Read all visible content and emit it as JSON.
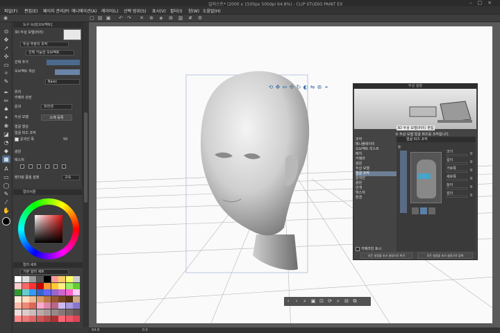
{
  "window": {
    "title": "일러스트* (2000 x 1500px 500dpi 64.8%) - CLIP STUDIO PAINT EX",
    "controls": [
      "–",
      "□",
      "×"
    ]
  },
  "menu": [
    "파일(F)",
    "편집(E)",
    "페이지 관리(P)",
    "애니메이션(A)",
    "레이어(L)",
    "선택 범위(S)",
    "표시(V)",
    "필터(I)",
    "창(W)",
    "도움말(H)"
  ],
  "tool_property": {
    "header": "도구 속성[오브젝트]",
    "title_label": "3D 두상 모델(머리)",
    "target_dropdown": "두상 부분의 조작",
    "selectable_dropdown": "선택 가능한 오브젝트",
    "select_add_label": "선택 추가",
    "tone_label": "오브젝트 색상",
    "layer_name": "Basic",
    "section_position": "위치",
    "section_camera": "카메라 관련",
    "section_outline": "윤곽",
    "outline_dropdown": "프리셋",
    "head_model_label": "두상 모델",
    "load_button": "소재 등록",
    "face_shape_label": "얼굴 형상",
    "face_parts_label": "얼굴 파츠 조작",
    "contour_label": "윤곽선 폭",
    "contour_value": "50",
    "section_light": "광원",
    "section_texture": "텍스처",
    "texture_dropdown": "고속",
    "render_label": "렌더링 품질 설정"
  },
  "color_panel": {
    "header": "컬러서클"
  },
  "swatch_panel": {
    "header": "컬러 세트",
    "set_name": "기본 컬러 세트",
    "colors": [
      "#ffffff",
      "#dddddd",
      "#999999",
      "#555555",
      "#000000",
      "#ff9999",
      "#ffcc66",
      "#ffff66",
      "#cccccc",
      "#ffcccc",
      "#ff6666",
      "#ff3333",
      "#cc0000",
      "#ff9933",
      "#ffcc33",
      "#ffee88",
      "#99ee66",
      "#66cc33",
      "#339933",
      "#66cccc",
      "#3399ff",
      "#3366cc",
      "#6666ff",
      "#9966cc",
      "#cc66cc",
      "#ff66cc",
      "#ffccff",
      "#ffeedd",
      "#ffddbb",
      "#eebb99",
      "#dd9966",
      "#bb7744",
      "#995533",
      "#774422",
      "#553311",
      "#ccaa88",
      "#ffbbaa",
      "#ee8877",
      "#dd6655",
      "#ffaacc",
      "#dd88aa",
      "#bb6688",
      "#ccbbee",
      "#aa99dd",
      "#8877cc",
      "#eedddd",
      "#ddcccc",
      "#ccbbbb",
      "#bbaaaa",
      "#aa9999",
      "#998888",
      "#887777",
      "#776666",
      "#665555",
      "#ff8888",
      "#ee7777",
      "#dd6666",
      "#cc5555",
      "#bb4444",
      "#aa3333",
      "#ff6677",
      "#ee5566",
      "#dd4455"
    ]
  },
  "canvas": {
    "zoom": "64.8",
    "status_zoom": "64.8",
    "status_angle": "0.0"
  },
  "head_dialog": {
    "title": "두상 설정",
    "preview_caption": "3D 두상 모델(머리) 편집",
    "help_text": "③ 두상 모델 얼굴 파츠를 조작합니다.",
    "nav_items": [
      "조작",
      "매니퓰레이터",
      "오브젝트 리스트",
      "배치",
      "카메라",
      "광원",
      "두상 모델",
      "얼굴 조작",
      "윤곽선",
      "광원",
      "안개",
      "텍스처",
      "환경"
    ],
    "selected_nav": "얼굴 조작",
    "panel_title": "얼굴 파츠 조작",
    "sub_title": "눈",
    "sliders": [
      {
        "label": "크기",
        "value": "0"
      },
      {
        "label": "길이",
        "value": "0"
      },
      {
        "label": "가로폭",
        "value": "0"
      },
      {
        "label": "세로폭",
        "value": "0"
      },
      {
        "label": "높이",
        "value": "0"
      },
      {
        "label": "깊이",
        "value": "0"
      }
    ],
    "checkbox_label": "카메라만 표시",
    "footer_left": "모든 설정을 초기 설정으로 복귀",
    "footer_right": "모든 설정을 초기 설정으로 등록"
  }
}
